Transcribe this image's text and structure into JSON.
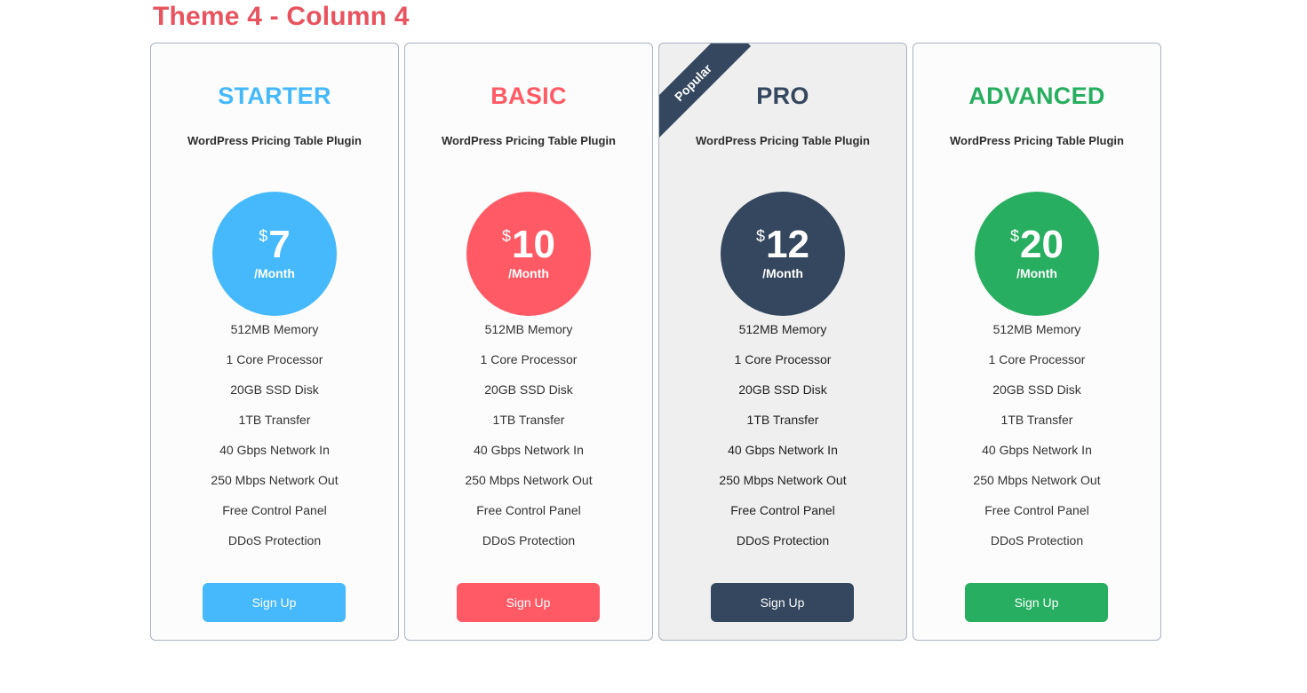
{
  "page": {
    "title": "Theme 4 - Column 4",
    "title_color": "#e8535f"
  },
  "plans": [
    {
      "name": "STARTER",
      "subtitle": "WordPress Pricing Table Plugin",
      "currency": "$",
      "price": "7",
      "period": "/Month",
      "color": "#45b9fc",
      "featured": false,
      "features": [
        "512MB Memory",
        "1 Core Processor",
        "20GB SSD Disk",
        "1TB Transfer",
        "40 Gbps Network In",
        "250 Mbps Network Out",
        "Free Control Panel",
        "DDoS Protection"
      ],
      "button_label": "Sign Up"
    },
    {
      "name": "BASIC",
      "subtitle": "WordPress Pricing Table Plugin",
      "currency": "$",
      "price": "10",
      "period": "/Month",
      "color": "#ff5a65",
      "featured": false,
      "features": [
        "512MB Memory",
        "1 Core Processor",
        "20GB SSD Disk",
        "1TB Transfer",
        "40 Gbps Network In",
        "250 Mbps Network Out",
        "Free Control Panel",
        "DDoS Protection"
      ],
      "button_label": "Sign Up"
    },
    {
      "name": "PRO",
      "subtitle": "WordPress Pricing Table Plugin",
      "currency": "$",
      "price": "12",
      "period": "/Month",
      "color": "#34475e",
      "featured": true,
      "ribbon": "Popular",
      "features": [
        "512MB Memory",
        "1 Core Processor",
        "20GB SSD Disk",
        "1TB Transfer",
        "40 Gbps Network In",
        "250 Mbps Network Out",
        "Free Control Panel",
        "DDoS Protection"
      ],
      "button_label": "Sign Up"
    },
    {
      "name": "ADVANCED",
      "subtitle": "WordPress Pricing Table Plugin",
      "currency": "$",
      "price": "20",
      "period": "/Month",
      "color": "#27ae60",
      "featured": false,
      "features": [
        "512MB Memory",
        "1 Core Processor",
        "20GB SSD Disk",
        "1TB Transfer",
        "40 Gbps Network In",
        "250 Mbps Network Out",
        "Free Control Panel",
        "DDoS Protection"
      ],
      "button_label": "Sign Up"
    }
  ]
}
